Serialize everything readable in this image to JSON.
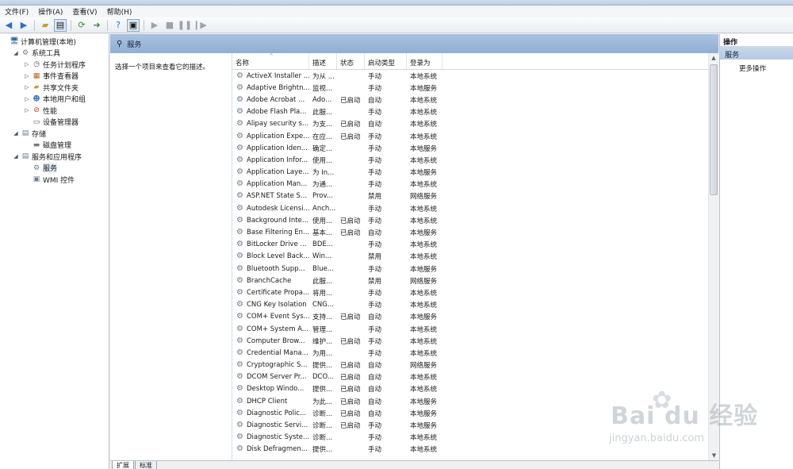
{
  "menu": [
    "文件(F)",
    "操作(A)",
    "查看(V)",
    "帮助(H)"
  ],
  "toolbar": {
    "icons": [
      "back-arrow-icon",
      "forward-arrow-icon",
      "up-folder-icon",
      "show-hide-tree-icon",
      "refresh-icon",
      "export-icon",
      "help-icon",
      "console-icon",
      "play-icon",
      "stop-icon",
      "pause-icon",
      "restart-icon"
    ]
  },
  "tree": [
    {
      "label": "计算机管理(本地)",
      "level": 0,
      "expander": "",
      "icon": "computer-icon"
    },
    {
      "label": "系统工具",
      "level": 1,
      "expander": "◢",
      "icon": "tools-icon"
    },
    {
      "label": "任务计划程序",
      "level": 2,
      "expander": "▷",
      "icon": "clock-icon"
    },
    {
      "label": "事件查看器",
      "level": 2,
      "expander": "▷",
      "icon": "event-icon"
    },
    {
      "label": "共享文件夹",
      "level": 2,
      "expander": "▷",
      "icon": "shared-folder-icon"
    },
    {
      "label": "本地用户和组",
      "level": 2,
      "expander": "▷",
      "icon": "users-icon"
    },
    {
      "label": "性能",
      "level": 2,
      "expander": "▷",
      "icon": "performance-icon"
    },
    {
      "label": "设备管理器",
      "level": 2,
      "expander": "",
      "icon": "device-icon"
    },
    {
      "label": "存储",
      "level": 1,
      "expander": "◢",
      "icon": "storage-icon"
    },
    {
      "label": "磁盘管理",
      "level": 2,
      "expander": "",
      "icon": "disk-icon"
    },
    {
      "label": "服务和应用程序",
      "level": 1,
      "expander": "◢",
      "icon": "apps-icon"
    },
    {
      "label": "服务",
      "level": 2,
      "expander": "",
      "icon": "services-icon"
    },
    {
      "label": "WMI 控件",
      "level": 2,
      "expander": "",
      "icon": "wmi-icon"
    }
  ],
  "center": {
    "header_title": "服务",
    "description_prompt": "选择一个项目来查看它的描述。",
    "columns": [
      "名称",
      "描述",
      "状态",
      "启动类型",
      "登录为"
    ],
    "services": [
      [
        "ActiveX Installer ...",
        "为从 ...",
        "",
        "手动",
        "本地系统"
      ],
      [
        "Adaptive Brightn...",
        "监视...",
        "",
        "手动",
        "本地服务"
      ],
      [
        "Adobe Acrobat ...",
        "Ado...",
        "已启动",
        "自动",
        "本地系统"
      ],
      [
        "Adobe Flash Pla...",
        "此服...",
        "",
        "手动",
        "本地系统"
      ],
      [
        "Alipay security s...",
        "为支...",
        "已启动",
        "自动",
        "本地系统"
      ],
      [
        "Application Expe...",
        "在应...",
        "已启动",
        "手动",
        "本地系统"
      ],
      [
        "Application Iden...",
        "确定...",
        "",
        "手动",
        "本地服务"
      ],
      [
        "Application Infor...",
        "使用...",
        "",
        "手动",
        "本地系统"
      ],
      [
        "Application Laye...",
        "为 In...",
        "",
        "手动",
        "本地服务"
      ],
      [
        "Application Man...",
        "为通...",
        "",
        "手动",
        "本地系统"
      ],
      [
        "ASP.NET State S...",
        "Prov...",
        "",
        "禁用",
        "网络服务"
      ],
      [
        "Autodesk Licensi...",
        "Anch...",
        "",
        "手动",
        "本地系统"
      ],
      [
        "Background Inte...",
        "使用...",
        "已启动",
        "手动",
        "本地系统"
      ],
      [
        "Base Filtering En...",
        "基本...",
        "已启动",
        "自动",
        "本地服务"
      ],
      [
        "BitLocker Drive ...",
        "BDE...",
        "",
        "手动",
        "本地系统"
      ],
      [
        "Block Level Back...",
        "Win...",
        "",
        "禁用",
        "本地系统"
      ],
      [
        "Bluetooth Supp...",
        "Blue...",
        "",
        "手动",
        "本地服务"
      ],
      [
        "BranchCache",
        "此服...",
        "",
        "禁用",
        "网络服务"
      ],
      [
        "Certificate Propa...",
        "将用...",
        "",
        "手动",
        "本地系统"
      ],
      [
        "CNG Key Isolation",
        "CNG...",
        "",
        "手动",
        "本地系统"
      ],
      [
        "COM+ Event Sys...",
        "支持...",
        "已启动",
        "自动",
        "本地服务"
      ],
      [
        "COM+ System A...",
        "管理...",
        "",
        "手动",
        "本地系统"
      ],
      [
        "Computer Brow...",
        "维护...",
        "已启动",
        "手动",
        "本地系统"
      ],
      [
        "Credential Mana...",
        "为用...",
        "",
        "手动",
        "本地系统"
      ],
      [
        "Cryptographic S...",
        "提供...",
        "已启动",
        "自动",
        "网络服务"
      ],
      [
        "DCOM Server Pr...",
        "DCO...",
        "已启动",
        "自动",
        "本地系统"
      ],
      [
        "Desktop Windo...",
        "提供...",
        "已启动",
        "自动",
        "本地系统"
      ],
      [
        "DHCP Client",
        "为此...",
        "已启动",
        "自动",
        "本地服务"
      ],
      [
        "Diagnostic Polic...",
        "诊断...",
        "已启动",
        "自动",
        "本地服务"
      ],
      [
        "Diagnostic Servi...",
        "诊断...",
        "已启动",
        "手动",
        "本地服务"
      ],
      [
        "Diagnostic Syste...",
        "诊断...",
        "",
        "手动",
        "本地系统"
      ],
      [
        "Disk Defragmen...",
        "提供...",
        "",
        "手动",
        "本地系统"
      ]
    ],
    "tabs": [
      "扩展",
      "标准"
    ]
  },
  "actions": {
    "title": "操作",
    "section": "服务",
    "more": "更多操作"
  },
  "watermark": {
    "brand": "Bai du 经验",
    "url": "jingyan.baidu.com"
  }
}
